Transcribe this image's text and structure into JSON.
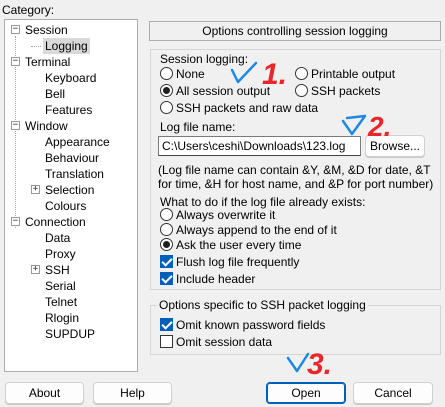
{
  "category_label": "Category:",
  "tree": {
    "items": [
      {
        "label": "Session"
      },
      {
        "label": "Logging"
      },
      {
        "label": "Terminal"
      },
      {
        "label": "Keyboard"
      },
      {
        "label": "Bell"
      },
      {
        "label": "Features"
      },
      {
        "label": "Window"
      },
      {
        "label": "Appearance"
      },
      {
        "label": "Behaviour"
      },
      {
        "label": "Translation"
      },
      {
        "label": "Selection"
      },
      {
        "label": "Colours"
      },
      {
        "label": "Connection"
      },
      {
        "label": "Data"
      },
      {
        "label": "Proxy"
      },
      {
        "label": "SSH"
      },
      {
        "label": "Serial"
      },
      {
        "label": "Telnet"
      },
      {
        "label": "Rlogin"
      },
      {
        "label": "SUPDUP"
      }
    ],
    "expander_minus": "−",
    "expander_plus": "+"
  },
  "panel": {
    "header": "Options controlling session logging",
    "session_logging": {
      "title": "Session logging:",
      "none": "None",
      "printable": "Printable output",
      "all": "All session output",
      "ssh": "SSH packets",
      "ssh_raw": "SSH packets and raw data",
      "selected": "All session output"
    },
    "log_file_label": "Log file name:",
    "log_file_value": "C:\\Users\\ceshi\\Downloads\\123.log",
    "browse": "Browse...",
    "note": "(Log file name can contain &Y, &M, &D for date, &T for time, &H for host name, and &P for port number)",
    "exists_label": "What to do if the log file already exists:",
    "overwrite": "Always overwrite it",
    "append": "Always append to the end of it",
    "ask": "Ask the user every time",
    "flush": "Flush log file frequently",
    "include_header": "Include header",
    "ssh_group_title": "Options specific to SSH packet logging",
    "omit_passwords": "Omit known password fields",
    "omit_session_data": "Omit session data"
  },
  "buttons": {
    "about": "About",
    "help": "Help",
    "open": "Open",
    "cancel": "Cancel"
  },
  "annotations": {
    "mark1": "1.",
    "mark2": "2.",
    "mark3": "3.",
    "ink_red": "#e8262b",
    "ink_blue": "#1e88e5"
  }
}
